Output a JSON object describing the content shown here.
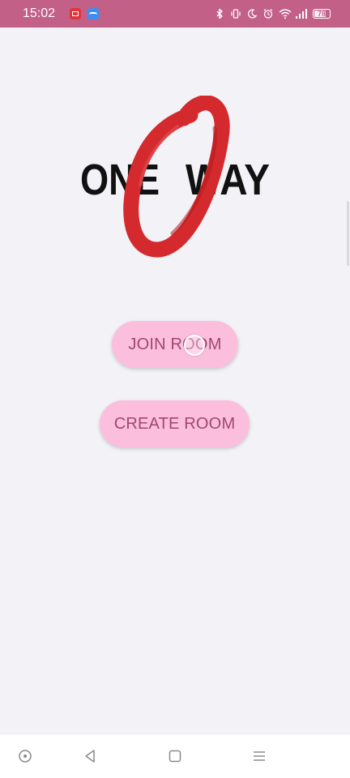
{
  "status_bar": {
    "time": "15:02",
    "notification_icons": [
      "red-app-icon",
      "blue-app-icon"
    ],
    "system_icons": [
      "bluetooth-icon",
      "vibrate-icon",
      "do-not-disturb-icon",
      "alarm-icon",
      "wifi-icon",
      "signal-icon"
    ],
    "battery_level": "78",
    "background_color": "#c26088"
  },
  "logo": {
    "text_left": "ONE",
    "text_right": "WAY",
    "circle_color": "#d42a2e"
  },
  "actions": {
    "join_label": "JOIN ROOM",
    "create_label": "CREATE ROOM",
    "button_color": "#fbbfdd",
    "button_text_color": "#a3466d"
  },
  "nav_bar": {
    "buttons": [
      "assistant-button",
      "back-button",
      "home-button",
      "menu-button"
    ]
  }
}
